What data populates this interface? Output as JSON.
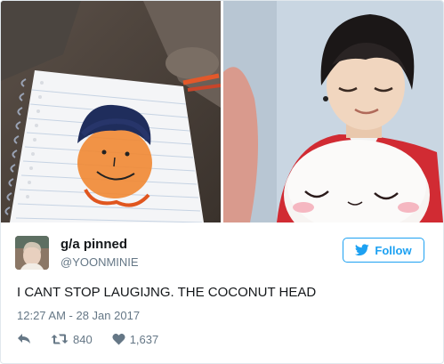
{
  "photos": {
    "left": {
      "subject": "notebook-drawing"
    },
    "right": {
      "subject": "person-with-plush"
    }
  },
  "user": {
    "display_name": "g/a pinned",
    "handle": "@YOONMINIE"
  },
  "follow_button": {
    "label": "Follow",
    "icon": "twitter-bird-icon",
    "color": "#1da1f2"
  },
  "tweet": {
    "text": "I CANT STOP LAUGIJNG. THE COCONUT HEAD",
    "timestamp": "12:27 AM - 28 Jan 2017"
  },
  "actions": {
    "reply": {
      "icon": "reply-icon"
    },
    "retweet": {
      "icon": "retweet-icon",
      "count": "840"
    },
    "like": {
      "icon": "heart-icon",
      "count": "1,637"
    }
  },
  "colors": {
    "accent": "#1da1f2",
    "text": "#14171a",
    "muted": "#657786",
    "border": "#e1e8ed"
  }
}
